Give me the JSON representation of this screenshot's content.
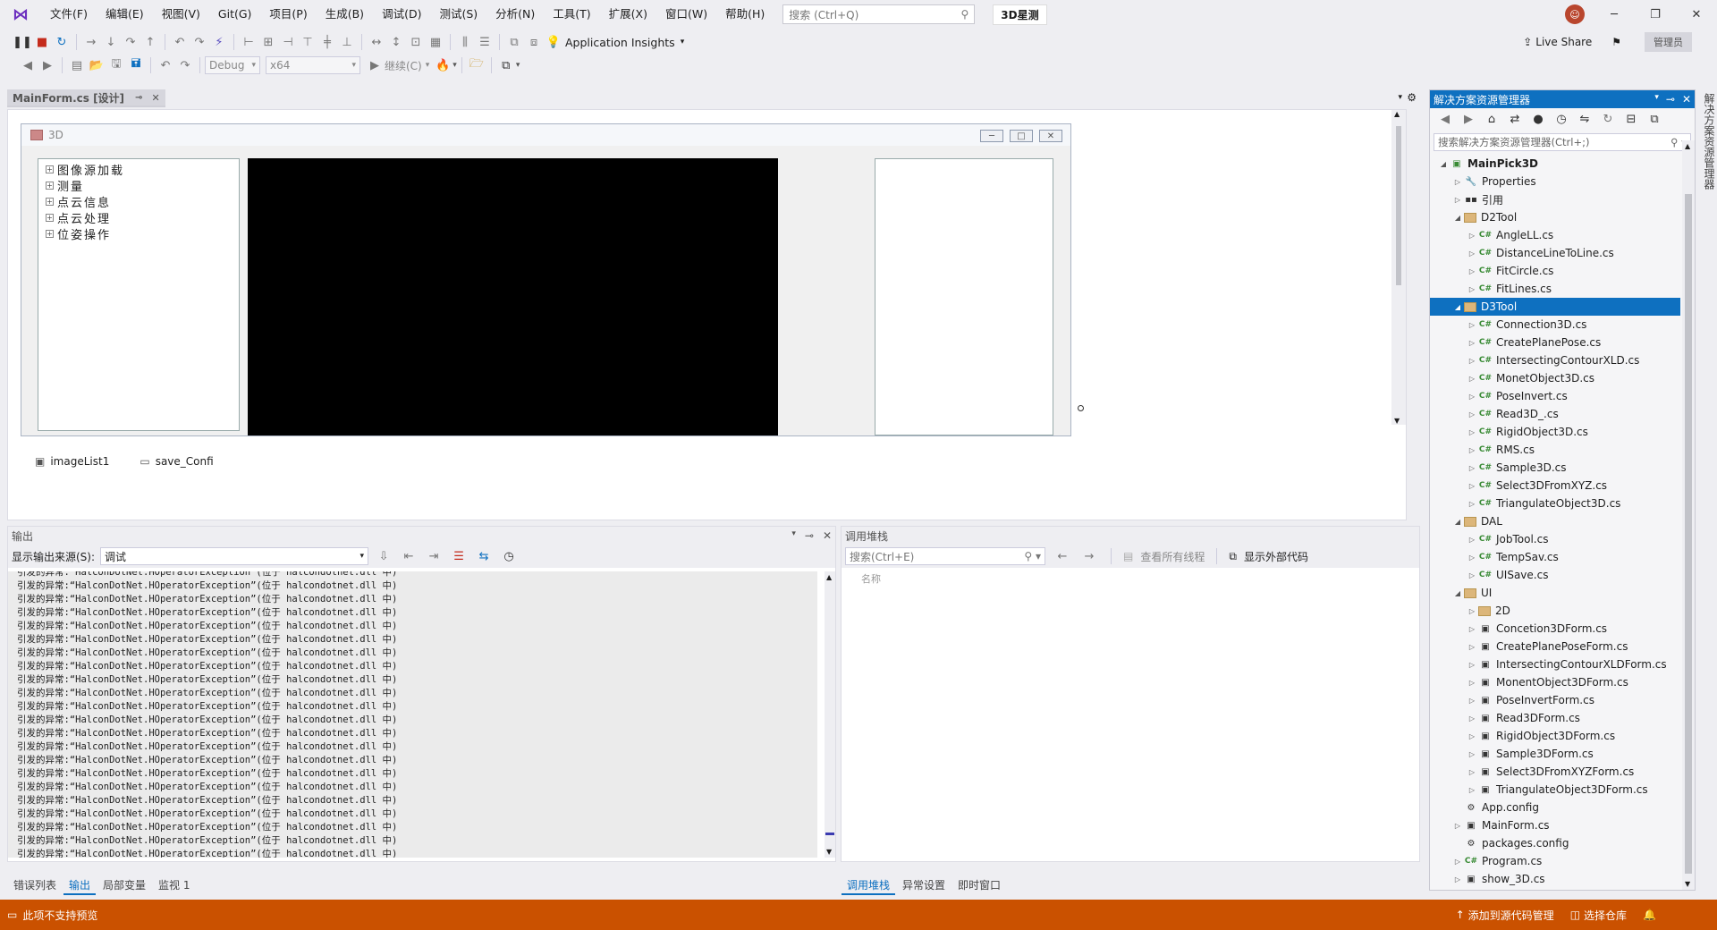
{
  "menubar": {
    "logo": "VS",
    "items": [
      "文件(F)",
      "编辑(E)",
      "视图(V)",
      "Git(G)",
      "项目(P)",
      "生成(B)",
      "调试(D)",
      "测试(S)",
      "分析(N)",
      "工具(T)",
      "扩展(X)",
      "窗口(W)",
      "帮助(H)"
    ],
    "search_placeholder": "搜索 (Ctrl+Q)",
    "solution_badge": "3D星测"
  },
  "toolbar": {
    "config": "Debug",
    "platform": "x64",
    "continue_label": "继续(C)",
    "app_insights": "Application Insights",
    "live_share": "Live Share",
    "admin_label": "管理员"
  },
  "doc_tab": {
    "label": "MainForm.cs [设计]"
  },
  "designer": {
    "form_title": "3D",
    "tree_nodes": [
      "图像源加载",
      "测量",
      "点云信息",
      "点云处理",
      "位姿操作"
    ],
    "tray_items": [
      "imageList1",
      "save_Confi"
    ]
  },
  "output": {
    "title": "输出",
    "source_label": "显示输出来源(S):",
    "source_value": "调试",
    "partial_line": "引发的异常:“HalconDotNet.HOperatorException”(位于 halcondotnet.dll 中)",
    "line": "引发的异常:“HalconDotNet.HOperatorException”(位于 halcondotnet.dll 中)",
    "line_count": 21,
    "tabs": [
      "错误列表",
      "输出",
      "局部变量",
      "监视 1"
    ],
    "active_tab": "输出"
  },
  "callstack": {
    "title": "调用堆栈",
    "search_placeholder": "搜索(Ctrl+E)",
    "view_all_threads": "查看所有线程",
    "show_external": "显示外部代码",
    "col_name": "名称",
    "tabs": [
      "调用堆栈",
      "异常设置",
      "即时窗口"
    ],
    "active_tab": "调用堆栈"
  },
  "solution_explorer": {
    "title": "解决方案资源管理器",
    "search_placeholder": "搜索解决方案资源管理器(Ctrl+;)",
    "items": [
      {
        "label": "MainPick3D",
        "level": 0,
        "type": "project",
        "arrow": "open",
        "bold": true
      },
      {
        "label": "Properties",
        "level": 1,
        "type": "wrench",
        "arrow": "closed"
      },
      {
        "label": "引用",
        "level": 1,
        "type": "ref",
        "arrow": "closed"
      },
      {
        "label": "D2Tool",
        "level": 1,
        "type": "folder",
        "arrow": "open"
      },
      {
        "label": "AngleLL.cs",
        "level": 2,
        "type": "cs",
        "arrow": "closed"
      },
      {
        "label": "DistanceLineToLine.cs",
        "level": 2,
        "type": "cs",
        "arrow": "closed"
      },
      {
        "label": "FitCircle.cs",
        "level": 2,
        "type": "cs",
        "arrow": "closed"
      },
      {
        "label": "FitLines.cs",
        "level": 2,
        "type": "cs",
        "arrow": "closed"
      },
      {
        "label": "D3Tool",
        "level": 1,
        "type": "folder",
        "arrow": "open",
        "selected": true
      },
      {
        "label": "Connection3D.cs",
        "level": 2,
        "type": "cs",
        "arrow": "closed"
      },
      {
        "label": "CreatePlanePose.cs",
        "level": 2,
        "type": "cs",
        "arrow": "closed"
      },
      {
        "label": "IntersectingContourXLD.cs",
        "level": 2,
        "type": "cs",
        "arrow": "closed"
      },
      {
        "label": "MonetObject3D.cs",
        "level": 2,
        "type": "cs",
        "arrow": "closed"
      },
      {
        "label": "PoseInvert.cs",
        "level": 2,
        "type": "cs",
        "arrow": "closed"
      },
      {
        "label": "Read3D_.cs",
        "level": 2,
        "type": "cs",
        "arrow": "closed"
      },
      {
        "label": "RigidObject3D.cs",
        "level": 2,
        "type": "cs",
        "arrow": "closed"
      },
      {
        "label": "RMS.cs",
        "level": 2,
        "type": "cs",
        "arrow": "closed"
      },
      {
        "label": "Sample3D.cs",
        "level": 2,
        "type": "cs",
        "arrow": "closed"
      },
      {
        "label": "Select3DFromXYZ.cs",
        "level": 2,
        "type": "cs",
        "arrow": "closed"
      },
      {
        "label": "TriangulateObject3D.cs",
        "level": 2,
        "type": "cs",
        "arrow": "closed"
      },
      {
        "label": "DAL",
        "level": 1,
        "type": "folder",
        "arrow": "open"
      },
      {
        "label": "JobTool.cs",
        "level": 2,
        "type": "cs",
        "arrow": "closed"
      },
      {
        "label": "TempSav.cs",
        "level": 2,
        "type": "cs",
        "arrow": "closed"
      },
      {
        "label": "UISave.cs",
        "level": 2,
        "type": "cs",
        "arrow": "closed"
      },
      {
        "label": "UI",
        "level": 1,
        "type": "folder",
        "arrow": "open"
      },
      {
        "label": "2D",
        "level": 2,
        "type": "folder",
        "arrow": "closed"
      },
      {
        "label": "Concetion3DForm.cs",
        "level": 2,
        "type": "form",
        "arrow": "closed"
      },
      {
        "label": "CreatePlanePoseForm.cs",
        "level": 2,
        "type": "form",
        "arrow": "closed"
      },
      {
        "label": "IntersectingContourXLDForm.cs",
        "level": 2,
        "type": "form",
        "arrow": "closed"
      },
      {
        "label": "MonentObject3DForm.cs",
        "level": 2,
        "type": "form",
        "arrow": "closed"
      },
      {
        "label": "PoseInvertForm.cs",
        "level": 2,
        "type": "form",
        "arrow": "closed"
      },
      {
        "label": "Read3DForm.cs",
        "level": 2,
        "type": "form",
        "arrow": "closed"
      },
      {
        "label": "RigidObject3DForm.cs",
        "level": 2,
        "type": "form",
        "arrow": "closed"
      },
      {
        "label": "Sample3DForm.cs",
        "level": 2,
        "type": "form",
        "arrow": "closed"
      },
      {
        "label": "Select3DFromXYZForm.cs",
        "level": 2,
        "type": "form",
        "arrow": "closed"
      },
      {
        "label": "TriangulateObject3DForm.cs",
        "level": 2,
        "type": "form",
        "arrow": "closed"
      },
      {
        "label": "App.config",
        "level": 1,
        "type": "config",
        "arrow": "none"
      },
      {
        "label": "MainForm.cs",
        "level": 1,
        "type": "form",
        "arrow": "closed"
      },
      {
        "label": "packages.config",
        "level": 1,
        "type": "config",
        "arrow": "none"
      },
      {
        "label": "Program.cs",
        "level": 1,
        "type": "cs",
        "arrow": "closed"
      },
      {
        "label": "show_3D.cs",
        "level": 1,
        "type": "form",
        "arrow": "closed"
      }
    ]
  },
  "side_rail": {
    "label": "解决方案资源管理器"
  },
  "statusbar": {
    "left": "此项不支持预览",
    "add_source_control": "添加到源代码管理",
    "select_repo": "选择仓库"
  },
  "colors": {
    "accent": "#0e70c0",
    "status": "#ca5100",
    "vs_purple": "#6c2fbf"
  }
}
